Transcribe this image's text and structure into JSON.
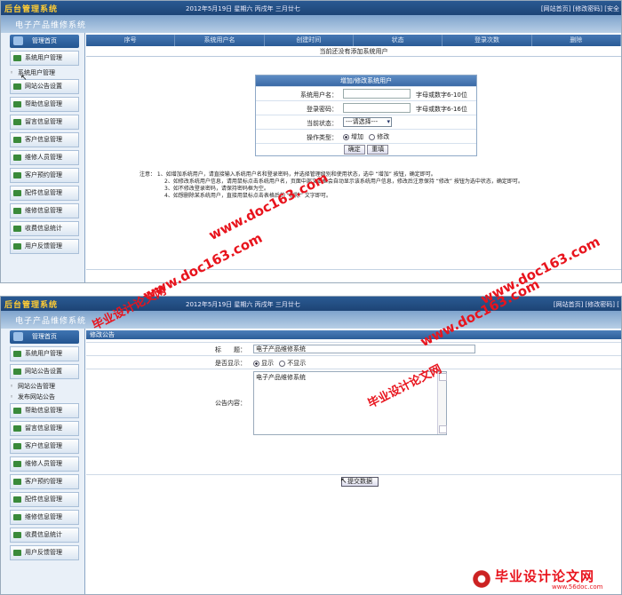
{
  "panel1": {
    "logo": "后台管理系统",
    "date": "2012年5月19日 星期六 丙戌年 三月廿七",
    "toplinks": "[网站首页] [修改密码] [安全",
    "subtitle": "电子产品维修系统",
    "sidebar": {
      "head": "管理首页",
      "items": [
        {
          "label": "系统用户管理",
          "type": "button"
        },
        {
          "label": "系统用户管理",
          "type": "sub"
        },
        {
          "label": "网站公告设置",
          "type": "button"
        },
        {
          "label": "帮助信息管理",
          "type": "button"
        },
        {
          "label": "留言信息管理",
          "type": "button"
        },
        {
          "label": "客户信息管理",
          "type": "button"
        },
        {
          "label": "维修人员管理",
          "type": "button"
        },
        {
          "label": "客户预约管理",
          "type": "button"
        },
        {
          "label": "配件信息管理",
          "type": "button"
        },
        {
          "label": "维修信息管理",
          "type": "button"
        },
        {
          "label": "收费信息统计",
          "type": "button"
        },
        {
          "label": "用户反馈管理",
          "type": "button"
        }
      ]
    },
    "table": {
      "columns": [
        "序号",
        "系统用户名",
        "创建时间",
        "状态",
        "登录次数",
        "删除"
      ],
      "empty": "当前还没有添加系统用户"
    },
    "form": {
      "title": "增加/修改系统用户",
      "username_label": "系统用户名：",
      "username_hint": "字母或数字6-10位",
      "password_label": "登录密码：",
      "password_hint": "字母或数字6-16位",
      "status_label": "当前状态：",
      "status_select": "---请选择---",
      "op_label": "操作类型：",
      "op_add": "增加",
      "op_edit": "修改",
      "confirm": "确定",
      "reset": "重填"
    },
    "notes": [
      "注意： 1、如增加系统用户，请直接输入系统用户名和登录密码，并选择管理级别和使用状态，选中 “增加” 按钮，确定即可。",
      "2、如修改系统用户信息，请用鼠标点击系统用户名，页面中部文本框会自动显示该系统用户信息，修改后注意保持 “修改” 按钮为选中状态，确定即可。",
      "3、如不修改登录密码，请保持密码框为空。",
      "4、如想删除某系统用户，直接用鼠标点击表格后的 “删除” 文字即可。"
    ]
  },
  "panel2": {
    "logo": "后台管理系统",
    "date": "2012年5月19日 星期六 丙戌年 三月廿七",
    "toplinks": "[网站首页] [修改密码] [",
    "subtitle": "电子产品维修系统",
    "sidebar": {
      "head": "管理首页",
      "items": [
        {
          "label": "系统用户管理",
          "type": "button"
        },
        {
          "label": "网站公告设置",
          "type": "button"
        },
        {
          "label": "网站公告管理",
          "type": "sub"
        },
        {
          "label": "发布网站公告",
          "type": "sub"
        },
        {
          "label": "帮助信息管理",
          "type": "button"
        },
        {
          "label": "留言信息管理",
          "type": "button"
        },
        {
          "label": "客户信息管理",
          "type": "button"
        },
        {
          "label": "维修人员管理",
          "type": "button"
        },
        {
          "label": "客户预约管理",
          "type": "button"
        },
        {
          "label": "配件信息管理",
          "type": "button"
        },
        {
          "label": "维修信息管理",
          "type": "button"
        },
        {
          "label": "收费信息统计",
          "type": "button"
        },
        {
          "label": "用户反馈管理",
          "type": "button"
        }
      ]
    },
    "edit": {
      "head": "修改公告",
      "title_label": "标　　题：",
      "title_value": "电子产品维修系统",
      "show_label": "是否显示：",
      "show_yes": "显示",
      "show_no": "不显示",
      "content_label": "公告内容：",
      "content_value": "电子产品维修系统",
      "submit": "提交数据"
    }
  },
  "watermarks": {
    "site_a": "www.doc163.com",
    "site_b": "毕业设计论文网",
    "badge_big": "毕业设计论文网",
    "badge_url": "www.56doc.com"
  }
}
